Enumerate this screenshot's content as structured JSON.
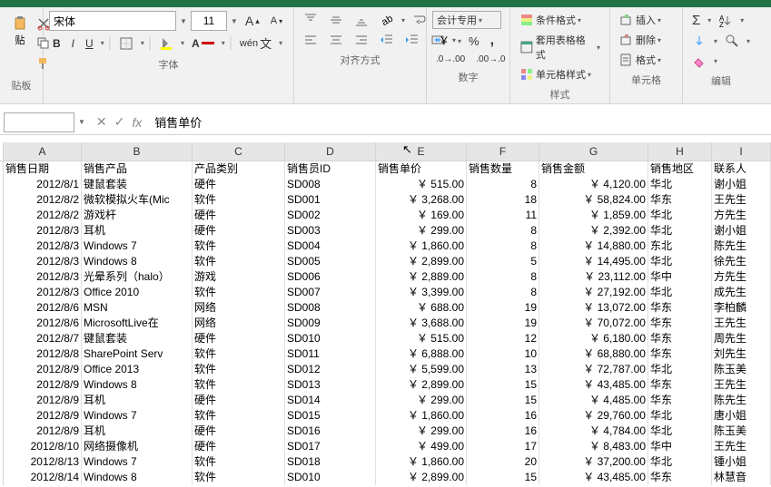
{
  "ribbon": {
    "font_name": "宋体",
    "font_size": "11",
    "bold": "B",
    "italic": "I",
    "underline": "U",
    "accounting_format": "会计专用",
    "conditional_format": "条件格式",
    "table_format": "套用表格格式",
    "cell_format": "单元格样式",
    "insert": "插入",
    "delete": "删除",
    "format": "格式",
    "group_clipboard": "贴板",
    "group_font": "字体",
    "group_align": "对齐方式",
    "group_number": "数字",
    "group_styles": "样式",
    "group_cells": "单元格",
    "group_edit": "编辑",
    "paste": "贴"
  },
  "formula_bar": {
    "name_box": "",
    "formula_value": "销售单价"
  },
  "columns": [
    "A",
    "B",
    "C",
    "D",
    "E",
    "F",
    "G",
    "H",
    "I"
  ],
  "headers": {
    "date": "销售日期",
    "product": "销售产品",
    "category": "产品类别",
    "salesid": "销售员ID",
    "price": "销售单价",
    "qty": "销售数量",
    "amount": "销售金额",
    "region": "销售地区",
    "contact": "联系人"
  },
  "chart_data": {
    "type": "table",
    "columns": [
      "销售日期",
      "销售产品",
      "产品类别",
      "销售员ID",
      "销售单价",
      "销售数量",
      "销售金额",
      "销售地区",
      "联系人"
    ],
    "rows": [
      [
        "2012/8/1",
        "键鼠套装",
        "硬件",
        "SD008",
        "￥    515.00",
        "8",
        "￥   4,120.00",
        "华北",
        "谢小姐"
      ],
      [
        "2012/8/2",
        "微软模拟火车(Mic",
        "软件",
        "SD001",
        "￥  3,268.00",
        "18",
        "￥  58,824.00",
        "华东",
        "王先生"
      ],
      [
        "2012/8/2",
        "游戏杆",
        "硬件",
        "SD002",
        "￥    169.00",
        "11",
        "￥   1,859.00",
        "华北",
        "方先生"
      ],
      [
        "2012/8/3",
        "耳机",
        "硬件",
        "SD003",
        "￥    299.00",
        "8",
        "￥   2,392.00",
        "华北",
        "谢小姐"
      ],
      [
        "2012/8/3",
        "Windows 7",
        "软件",
        "SD004",
        "￥  1,860.00",
        "8",
        "￥  14,880.00",
        "东北",
        "陈先生"
      ],
      [
        "2012/8/3",
        "Windows 8",
        "软件",
        "SD005",
        "￥  2,899.00",
        "5",
        "￥  14,495.00",
        "华北",
        "徐先生"
      ],
      [
        "2012/8/3",
        "光晕系列（halo）",
        "游戏",
        "SD006",
        "￥  2,889.00",
        "8",
        "￥  23,112.00",
        "华中",
        "方先生"
      ],
      [
        "2012/8/3",
        "Office 2010",
        "软件",
        "SD007",
        "￥  3,399.00",
        "8",
        "￥  27,192.00",
        "华北",
        "成先生"
      ],
      [
        "2012/8/6",
        "MSN",
        "网络",
        "SD008",
        "￥    688.00",
        "19",
        "￥  13,072.00",
        "华东",
        "李柏麟"
      ],
      [
        "2012/8/6",
        "MicrosoftLive在",
        "网络",
        "SD009",
        "￥  3,688.00",
        "19",
        "￥  70,072.00",
        "华东",
        "王先生"
      ],
      [
        "2012/8/7",
        "键鼠套装",
        "硬件",
        "SD010",
        "￥    515.00",
        "12",
        "￥   6,180.00",
        "华东",
        "周先生"
      ],
      [
        "2012/8/8",
        "SharePoint Serv",
        "软件",
        "SD011",
        "￥  6,888.00",
        "10",
        "￥  68,880.00",
        "华东",
        "刘先生"
      ],
      [
        "2012/8/9",
        "Office 2013",
        "软件",
        "SD012",
        "￥  5,599.00",
        "13",
        "￥  72,787.00",
        "华北",
        "陈玉美"
      ],
      [
        "2012/8/9",
        "Windows 8",
        "软件",
        "SD013",
        "￥  2,899.00",
        "15",
        "￥  43,485.00",
        "华东",
        "王先生"
      ],
      [
        "2012/8/9",
        "耳机",
        "硬件",
        "SD014",
        "￥    299.00",
        "15",
        "￥   4,485.00",
        "华东",
        "陈先生"
      ],
      [
        "2012/8/9",
        "Windows 7",
        "软件",
        "SD015",
        "￥  1,860.00",
        "16",
        "￥  29,760.00",
        "华北",
        "唐小姐"
      ],
      [
        "2012/8/9",
        "耳机",
        "硬件",
        "SD016",
        "￥    299.00",
        "16",
        "￥   4,784.00",
        "华北",
        "陈玉美"
      ],
      [
        "2012/8/10",
        "网络摄像机",
        "硬件",
        "SD017",
        "￥    499.00",
        "17",
        "￥   8,483.00",
        "华中",
        "王先生"
      ],
      [
        "2012/8/13",
        "Windows 7",
        "软件",
        "SD018",
        "￥  1,860.00",
        "20",
        "￥  37,200.00",
        "华北",
        "锺小姐"
      ],
      [
        "2012/8/14",
        "Windows 8",
        "软件",
        "SD010",
        "￥  2,899.00",
        "15",
        "￥  43,485.00",
        "华东",
        "林慧音"
      ]
    ]
  }
}
